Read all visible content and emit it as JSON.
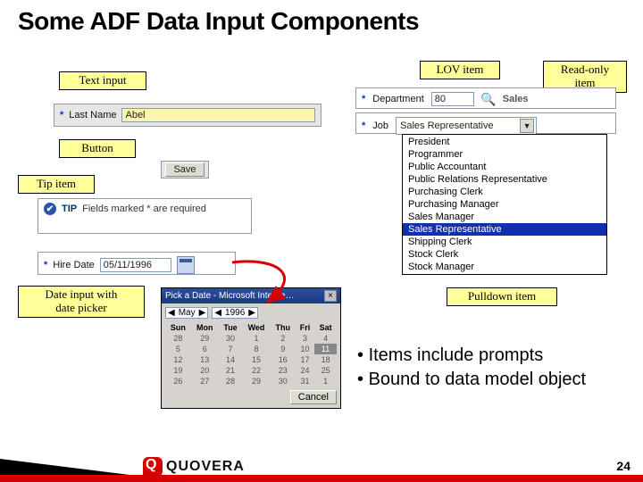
{
  "title": "Some ADF Data Input Components",
  "callouts": {
    "text_input": "Text input",
    "button": "Button",
    "tip_item": "Tip item",
    "date_input": "Date input with\ndate picker",
    "lov_item": "LOV item",
    "readonly_item": "Read-only\nitem",
    "pulldown_item": "Pulldown item"
  },
  "text_input": {
    "label": "Last Name",
    "value": "Abel"
  },
  "button": {
    "label": "Save"
  },
  "tip": {
    "prefix": "TIP",
    "text": "Fields marked * are required"
  },
  "date": {
    "label": "Hire Date",
    "value": "05/11/1996"
  },
  "lov": {
    "label": "Department",
    "value": "80"
  },
  "readonly": {
    "label": "Sales"
  },
  "pulldown": {
    "label": "Job",
    "value": "Sales Representative",
    "options": [
      "President",
      "Programmer",
      "Public Accountant",
      "Public Relations Representative",
      "Purchasing Clerk",
      "Purchasing Manager",
      "Sales Manager",
      "Sales Representative",
      "Shipping Clerk",
      "Stock Clerk",
      "Stock Manager"
    ],
    "selected_index": 7
  },
  "date_picker": {
    "title": "Pick a Date - Microsoft Interne…",
    "month": "May",
    "year": "1996",
    "dow": [
      "Sun",
      "Mon",
      "Tue",
      "Wed",
      "Thu",
      "Fri",
      "Sat"
    ],
    "weeks": [
      [
        "28",
        "29",
        "30",
        "1",
        "2",
        "3",
        "4"
      ],
      [
        "5",
        "6",
        "7",
        "8",
        "9",
        "10",
        "11"
      ],
      [
        "12",
        "13",
        "14",
        "15",
        "16",
        "17",
        "18"
      ],
      [
        "19",
        "20",
        "21",
        "22",
        "23",
        "24",
        "25"
      ],
      [
        "26",
        "27",
        "28",
        "29",
        "30",
        "31",
        "1"
      ]
    ],
    "today_cell": "11",
    "cancel": "Cancel"
  },
  "bullets": [
    "Items include prompts",
    "Bound to data model object"
  ],
  "logo_text": "QUOVERA",
  "page_number": "24"
}
